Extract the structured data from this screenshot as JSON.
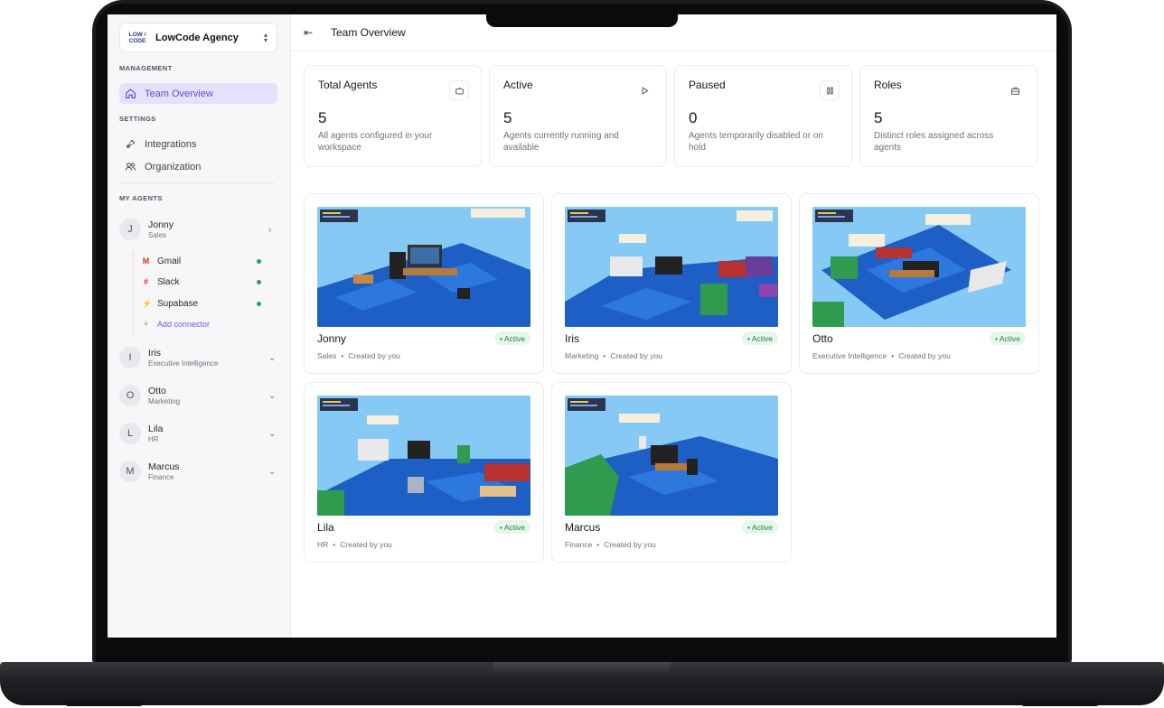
{
  "sidebar": {
    "org_logo_top": "LOW /",
    "org_logo_bottom": "CODE",
    "org_name": "LowCode Agency",
    "management_label": "MANAGEMENT",
    "nav_team_overview": "Team Overview",
    "settings_label": "SETTINGS",
    "nav_integrations": "Integrations",
    "nav_organization": "Organization",
    "my_agents_label": "MY AGENTS",
    "agents": [
      {
        "initial": "J",
        "name": "Jonny",
        "role": "Sales"
      },
      {
        "initial": "I",
        "name": "Iris",
        "role": "Executive Intelligence"
      },
      {
        "initial": "O",
        "name": "Otto",
        "role": "Marketing"
      },
      {
        "initial": "L",
        "name": "Lila",
        "role": "HR"
      },
      {
        "initial": "M",
        "name": "Marcus",
        "role": "Finance"
      }
    ],
    "connectors": [
      "Gmail",
      "Slack",
      "Supabase"
    ],
    "add_connector": "Add connector"
  },
  "header": {
    "title": "Team Overview"
  },
  "stats": [
    {
      "title": "Total Agents",
      "value": "5",
      "desc": "All agents configured in your workspace",
      "icon": "robot-icon"
    },
    {
      "title": "Active",
      "value": "5",
      "desc": "Agents currently running and available",
      "icon": "play-icon"
    },
    {
      "title": "Paused",
      "value": "0",
      "desc": "Agents temporarily disabled or on hold",
      "icon": "pause-icon"
    },
    {
      "title": "Roles",
      "value": "5",
      "desc": "Distinct roles assigned across agents",
      "icon": "briefcase-icon"
    }
  ],
  "cards": [
    {
      "name": "Jonny",
      "role": "Sales",
      "status": "• Active",
      "created": "Created by you"
    },
    {
      "name": "Iris",
      "role": "Marketing",
      "status": "• Active",
      "created": "Created by you"
    },
    {
      "name": "Otto",
      "role": "Executive Intelligence",
      "status": "• Active",
      "created": "Created by you"
    },
    {
      "name": "Lila",
      "role": "HR",
      "status": "• Active",
      "created": "Created by you"
    },
    {
      "name": "Marcus",
      "role": "Finance",
      "status": "• Active",
      "created": "Created by you"
    }
  ],
  "colors": {
    "accent": "#5b4fd6",
    "active_bg": "#e4e1fb",
    "status_green": "#22a35a",
    "sky": "#87c9f5",
    "floor": "#1d5fc4"
  }
}
